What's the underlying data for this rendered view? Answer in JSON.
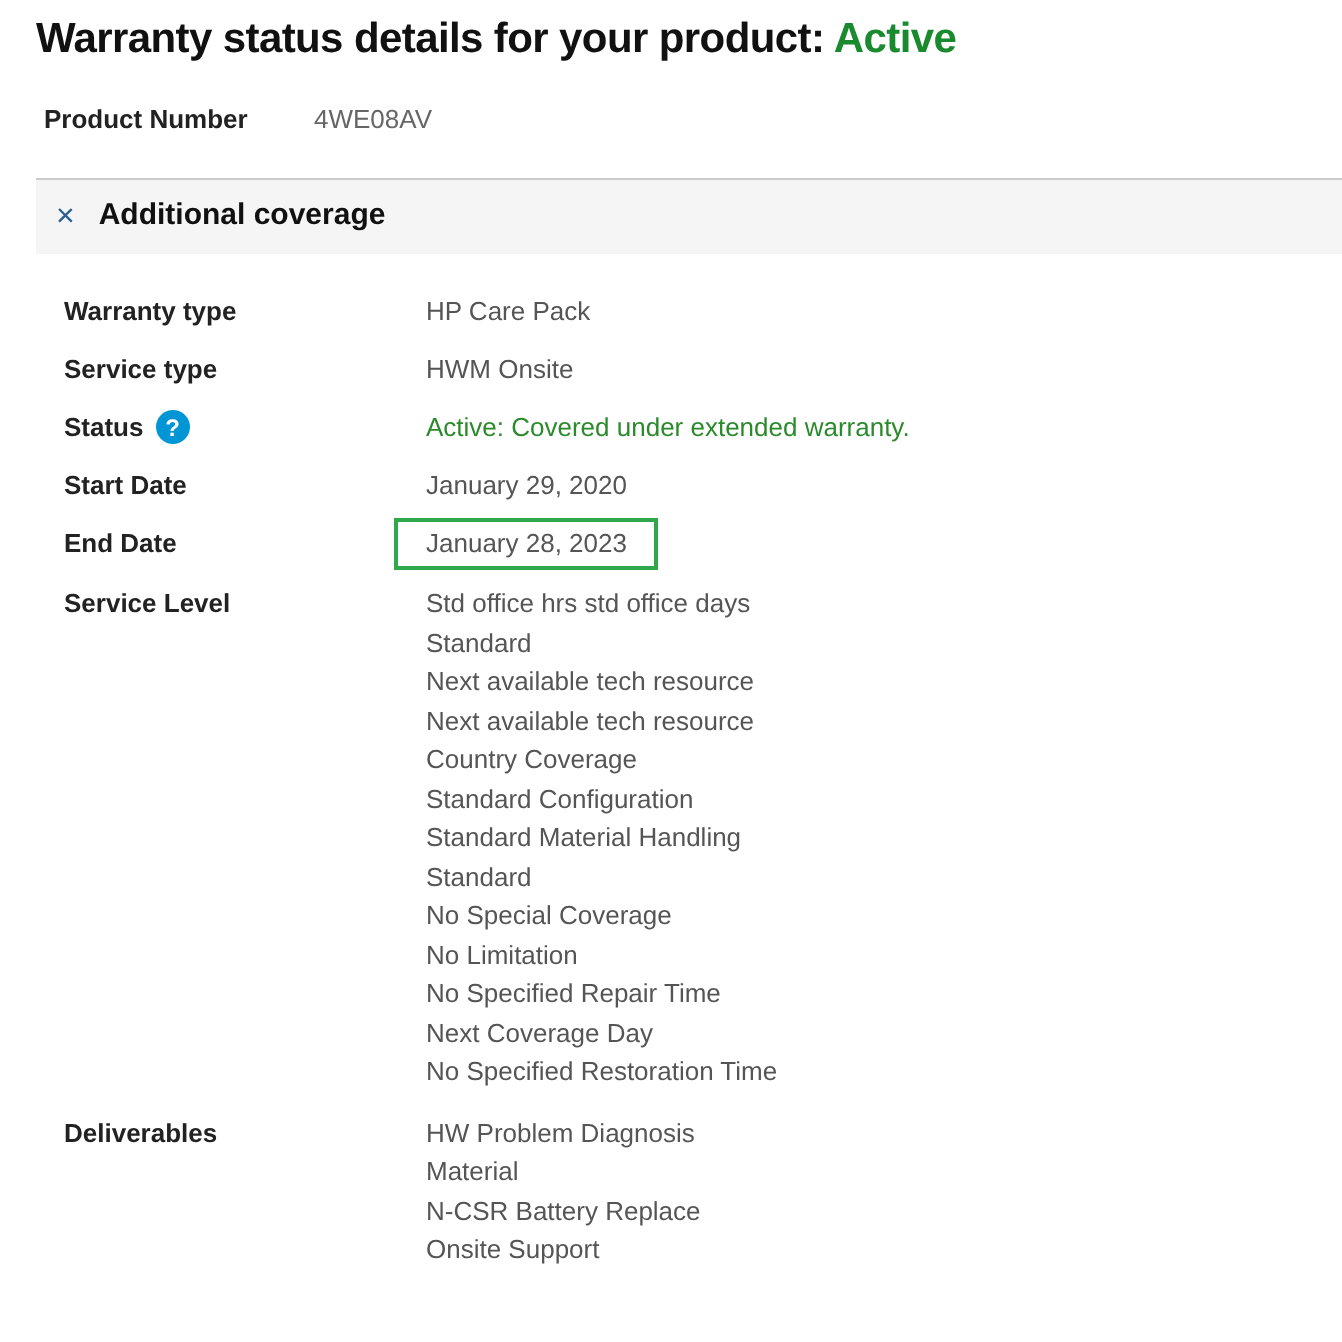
{
  "title": {
    "text": "Warranty status details for your product:",
    "status": "Active"
  },
  "product": {
    "label": "Product Number",
    "value": "4WE08AV"
  },
  "section": {
    "close_glyph": "×",
    "title": "Additional coverage",
    "expanded": true
  },
  "rows": [
    {
      "kind": "plain",
      "label": "Warranty type",
      "values": [
        "HP Care Pack"
      ]
    },
    {
      "kind": "plain",
      "label": "Service type",
      "values": [
        "HWM Onsite"
      ]
    },
    {
      "kind": "status",
      "label": "Status",
      "help_glyph": "?",
      "values": [
        "Active: Covered under extended warranty."
      ]
    },
    {
      "kind": "plain",
      "label": "Start Date",
      "values": [
        "January 29, 2020"
      ]
    },
    {
      "kind": "highlighted",
      "label": "End Date",
      "values": [
        "January 28, 2023"
      ]
    },
    {
      "kind": "list",
      "label": "Service Level",
      "values": [
        "Std office hrs std office days",
        "Standard",
        "Next available tech resource",
        "Next available tech resource",
        "Country Coverage",
        "Standard Configuration",
        "Standard Material Handling",
        "Standard",
        "No Special Coverage",
        "No Limitation",
        "No Specified Repair Time",
        "Next Coverage Day",
        "No Specified Restoration Time"
      ]
    },
    {
      "kind": "list",
      "label": "Deliverables",
      "values": [
        "HW Problem Diagnosis",
        "Material",
        "N-CSR Battery Replace",
        "Onsite Support"
      ]
    }
  ]
}
